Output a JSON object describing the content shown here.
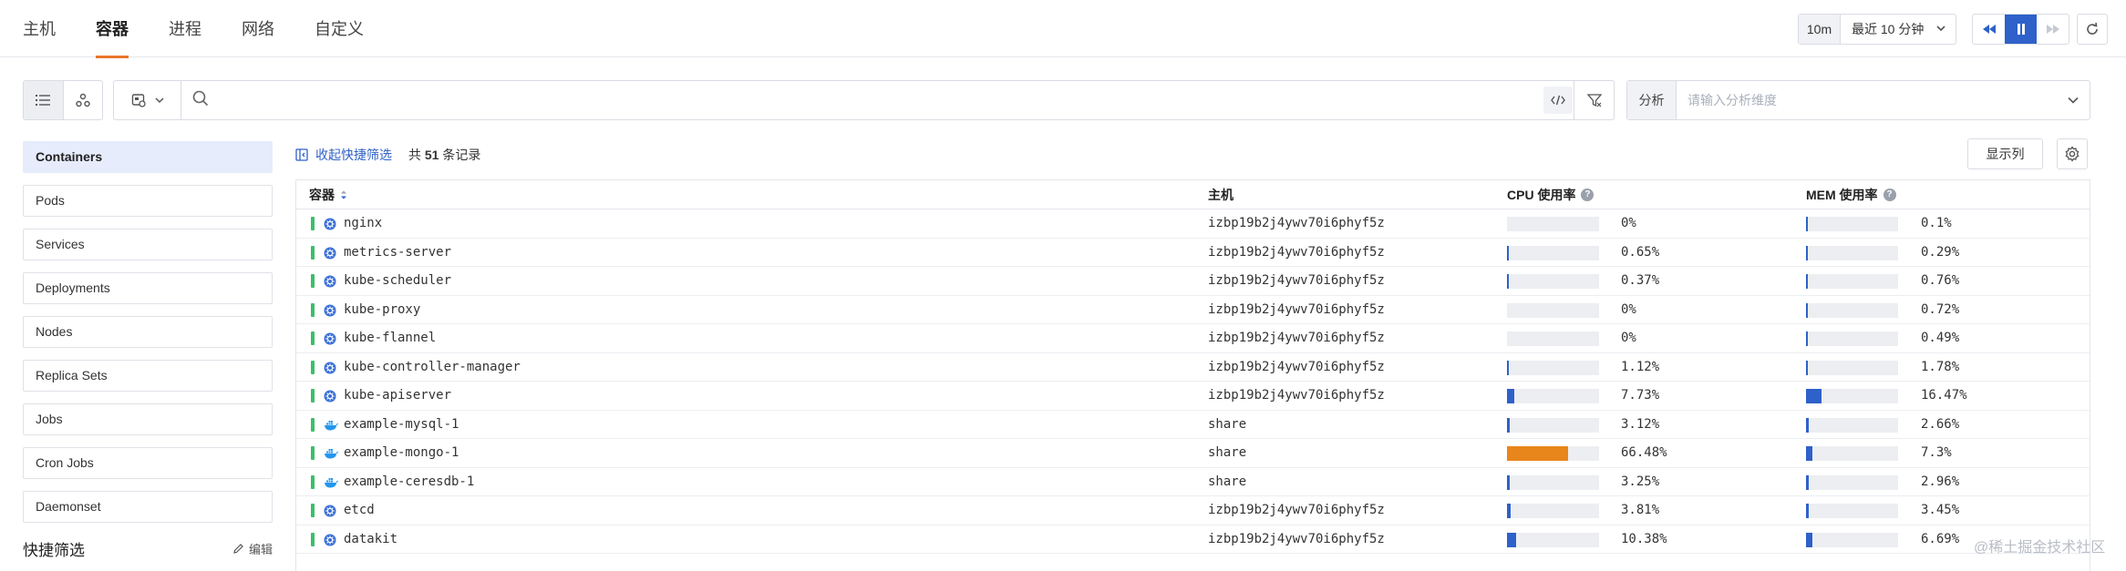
{
  "tabs": [
    {
      "label": "主机",
      "active": false
    },
    {
      "label": "容器",
      "active": true
    },
    {
      "label": "进程",
      "active": false
    },
    {
      "label": "网络",
      "active": false
    },
    {
      "label": "自定义",
      "active": false
    }
  ],
  "time": {
    "quick": "10m",
    "range": "最近 10 分钟",
    "playing": true
  },
  "search": {
    "placeholder": "",
    "value": ""
  },
  "analysis": {
    "label": "分析",
    "placeholder": "请输入分析维度"
  },
  "sidebar": {
    "items": [
      {
        "label": "Containers",
        "active": true
      },
      {
        "label": "Pods"
      },
      {
        "label": "Services"
      },
      {
        "label": "Deployments"
      },
      {
        "label": "Nodes"
      },
      {
        "label": "Replica Sets"
      },
      {
        "label": "Jobs"
      },
      {
        "label": "Cron Jobs"
      },
      {
        "label": "Daemonset"
      }
    ],
    "quick_filter_title": "快捷筛选",
    "edit_label": "编辑"
  },
  "list": {
    "collapse_label": "收起快捷筛选",
    "count_prefix": "共",
    "count": "51",
    "count_suffix": "条记录",
    "columns_button": "显示列"
  },
  "table": {
    "columns": {
      "name": "容器",
      "host": "主机",
      "cpu": "CPU 使用率",
      "mem": "MEM 使用率"
    },
    "rows": [
      {
        "name": "nginx",
        "host": "izbp19b2j4ywv70i6phyf5z",
        "icon": "kubernetes-icon",
        "cpu": "0%",
        "cpu_val": 0,
        "mem": "0.1%",
        "mem_val": 0.1
      },
      {
        "name": "metrics-server",
        "host": "izbp19b2j4ywv70i6phyf5z",
        "icon": "kubernetes-icon",
        "cpu": "0.65%",
        "cpu_val": 0.65,
        "mem": "0.29%",
        "mem_val": 0.29
      },
      {
        "name": "kube-scheduler",
        "host": "izbp19b2j4ywv70i6phyf5z",
        "icon": "kubernetes-icon",
        "cpu": "0.37%",
        "cpu_val": 0.37,
        "mem": "0.76%",
        "mem_val": 0.76
      },
      {
        "name": "kube-proxy",
        "host": "izbp19b2j4ywv70i6phyf5z",
        "icon": "kubernetes-icon",
        "cpu": "0%",
        "cpu_val": 0,
        "mem": "0.72%",
        "mem_val": 0.72
      },
      {
        "name": "kube-flannel",
        "host": "izbp19b2j4ywv70i6phyf5z",
        "icon": "kubernetes-icon",
        "cpu": "0%",
        "cpu_val": 0,
        "mem": "0.49%",
        "mem_val": 0.49
      },
      {
        "name": "kube-controller-manager",
        "host": "izbp19b2j4ywv70i6phyf5z",
        "icon": "kubernetes-icon",
        "cpu": "1.12%",
        "cpu_val": 1.12,
        "mem": "1.78%",
        "mem_val": 1.78
      },
      {
        "name": "kube-apiserver",
        "host": "izbp19b2j4ywv70i6phyf5z",
        "icon": "kubernetes-icon",
        "cpu": "7.73%",
        "cpu_val": 7.73,
        "mem": "16.47%",
        "mem_val": 16.47
      },
      {
        "name": "example-mysql-1",
        "host": "share",
        "icon": "docker-icon",
        "cpu": "3.12%",
        "cpu_val": 3.12,
        "mem": "2.66%",
        "mem_val": 2.66
      },
      {
        "name": "example-mongo-1",
        "host": "share",
        "icon": "docker-icon",
        "cpu": "66.48%",
        "cpu_val": 66.48,
        "mem": "7.3%",
        "mem_val": 7.3
      },
      {
        "name": "example-ceresdb-1",
        "host": "share",
        "icon": "docker-icon",
        "cpu": "3.25%",
        "cpu_val": 3.25,
        "mem": "2.96%",
        "mem_val": 2.96
      },
      {
        "name": "etcd",
        "host": "izbp19b2j4ywv70i6phyf5z",
        "icon": "kubernetes-icon",
        "cpu": "3.81%",
        "cpu_val": 3.81,
        "mem": "3.45%",
        "mem_val": 3.45
      },
      {
        "name": "datakit",
        "host": "izbp19b2j4ywv70i6phyf5z",
        "icon": "kubernetes-icon",
        "cpu": "10.38%",
        "cpu_val": 10.38,
        "mem": "6.69%",
        "mem_val": 6.69
      }
    ]
  },
  "colors": {
    "accent": "#2e61c9",
    "tab_active": "#e8772a",
    "status_ok": "#3bbf6a",
    "bar_high": "#e8861c"
  },
  "watermark": "@稀土掘金技术社区"
}
